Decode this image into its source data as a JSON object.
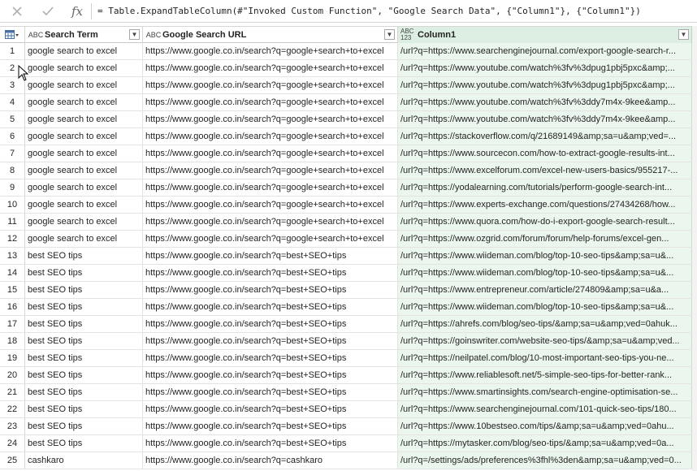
{
  "formula_bar": {
    "cancel_icon": "close-icon",
    "commit_icon": "check-icon",
    "fx_label": "fx",
    "formula": "= Table.ExpandTableColumn(#\"Invoked Custom Function\", \"Google Search Data\", {\"Column1\"}, {\"Column1\"})"
  },
  "columns": [
    {
      "type_label": "ABC",
      "title": "Search Term",
      "icon": "text-type-icon"
    },
    {
      "type_label": "ABC",
      "title": "Google Search URL",
      "icon": "text-type-icon"
    },
    {
      "type_label": "ABC 123",
      "title": "Column1",
      "icon": "any-type-icon"
    }
  ],
  "rows": [
    {
      "n": "1",
      "a": "google search to excel",
      "b": "https://www.google.co.in/search?q=google+search+to+excel",
      "c": "/url?q=https://www.searchenginejournal.com/export-google-search-r..."
    },
    {
      "n": "2",
      "a": "google search to excel",
      "b": "https://www.google.co.in/search?q=google+search+to+excel",
      "c": "/url?q=https://www.youtube.com/watch%3fv%3dpug1pbj5pxc&amp;..."
    },
    {
      "n": "3",
      "a": "google search to excel",
      "b": "https://www.google.co.in/search?q=google+search+to+excel",
      "c": "/url?q=https://www.youtube.com/watch%3fv%3dpug1pbj5pxc&amp;..."
    },
    {
      "n": "4",
      "a": "google search to excel",
      "b": "https://www.google.co.in/search?q=google+search+to+excel",
      "c": "/url?q=https://www.youtube.com/watch%3fv%3ddy7m4x-9kee&amp..."
    },
    {
      "n": "5",
      "a": "google search to excel",
      "b": "https://www.google.co.in/search?q=google+search+to+excel",
      "c": "/url?q=https://www.youtube.com/watch%3fv%3ddy7m4x-9kee&amp..."
    },
    {
      "n": "6",
      "a": "google search to excel",
      "b": "https://www.google.co.in/search?q=google+search+to+excel",
      "c": "/url?q=https://stackoverflow.com/q/21689149&amp;sa=u&amp;ved=..."
    },
    {
      "n": "7",
      "a": "google search to excel",
      "b": "https://www.google.co.in/search?q=google+search+to+excel",
      "c": "/url?q=https://www.sourcecon.com/how-to-extract-google-results-int..."
    },
    {
      "n": "8",
      "a": "google search to excel",
      "b": "https://www.google.co.in/search?q=google+search+to+excel",
      "c": "/url?q=https://www.excelforum.com/excel-new-users-basics/955217-..."
    },
    {
      "n": "9",
      "a": "google search to excel",
      "b": "https://www.google.co.in/search?q=google+search+to+excel",
      "c": "/url?q=https://yodalearning.com/tutorials/perform-google-search-int..."
    },
    {
      "n": "10",
      "a": "google search to excel",
      "b": "https://www.google.co.in/search?q=google+search+to+excel",
      "c": "/url?q=https://www.experts-exchange.com/questions/27434268/how..."
    },
    {
      "n": "11",
      "a": "google search to excel",
      "b": "https://www.google.co.in/search?q=google+search+to+excel",
      "c": "/url?q=https://www.quora.com/how-do-i-export-google-search-result..."
    },
    {
      "n": "12",
      "a": "google search to excel",
      "b": "https://www.google.co.in/search?q=google+search+to+excel",
      "c": "/url?q=https://www.ozgrid.com/forum/forum/help-forums/excel-gen..."
    },
    {
      "n": "13",
      "a": "best SEO tips",
      "b": "https://www.google.co.in/search?q=best+SEO+tips",
      "c": "/url?q=https://www.wiideman.com/blog/top-10-seo-tips&amp;sa=u&..."
    },
    {
      "n": "14",
      "a": "best SEO tips",
      "b": "https://www.google.co.in/search?q=best+SEO+tips",
      "c": "/url?q=https://www.wiideman.com/blog/top-10-seo-tips&amp;sa=u&..."
    },
    {
      "n": "15",
      "a": "best SEO tips",
      "b": "https://www.google.co.in/search?q=best+SEO+tips",
      "c": "/url?q=https://www.entrepreneur.com/article/274809&amp;sa=u&a..."
    },
    {
      "n": "16",
      "a": "best SEO tips",
      "b": "https://www.google.co.in/search?q=best+SEO+tips",
      "c": "/url?q=https://www.wiideman.com/blog/top-10-seo-tips&amp;sa=u&..."
    },
    {
      "n": "17",
      "a": "best SEO tips",
      "b": "https://www.google.co.in/search?q=best+SEO+tips",
      "c": "/url?q=https://ahrefs.com/blog/seo-tips/&amp;sa=u&amp;ved=0ahuk..."
    },
    {
      "n": "18",
      "a": "best SEO tips",
      "b": "https://www.google.co.in/search?q=best+SEO+tips",
      "c": "/url?q=https://goinswriter.com/website-seo-tips/&amp;sa=u&amp;ved..."
    },
    {
      "n": "19",
      "a": "best SEO tips",
      "b": "https://www.google.co.in/search?q=best+SEO+tips",
      "c": "/url?q=https://neilpatel.com/blog/10-most-important-seo-tips-you-ne..."
    },
    {
      "n": "20",
      "a": "best SEO tips",
      "b": "https://www.google.co.in/search?q=best+SEO+tips",
      "c": "/url?q=https://www.reliablesoft.net/5-simple-seo-tips-for-better-rank..."
    },
    {
      "n": "21",
      "a": "best SEO tips",
      "b": "https://www.google.co.in/search?q=best+SEO+tips",
      "c": "/url?q=https://www.smartinsights.com/search-engine-optimisation-se..."
    },
    {
      "n": "22",
      "a": "best SEO tips",
      "b": "https://www.google.co.in/search?q=best+SEO+tips",
      "c": "/url?q=https://www.searchenginejournal.com/101-quick-seo-tips/180..."
    },
    {
      "n": "23",
      "a": "best SEO tips",
      "b": "https://www.google.co.in/search?q=best+SEO+tips",
      "c": "/url?q=https://www.10bestseo.com/tips/&amp;sa=u&amp;ved=0ahu..."
    },
    {
      "n": "24",
      "a": "best SEO tips",
      "b": "https://www.google.co.in/search?q=best+SEO+tips",
      "c": "/url?q=https://mytasker.com/blog/seo-tips/&amp;sa=u&amp;ved=0a..."
    },
    {
      "n": "25",
      "a": "cashkaro",
      "b": "https://www.google.co.in/search?q=cashkaro",
      "c": "/url?q=/settings/ads/preferences%3fhl%3den&amp;sa=u&amp;ved=0..."
    }
  ],
  "colors": {
    "column1_header_bg": "#dcefe2",
    "column1_cell_bg": "#eaf6ee",
    "grid_line": "#e3e3e3"
  }
}
